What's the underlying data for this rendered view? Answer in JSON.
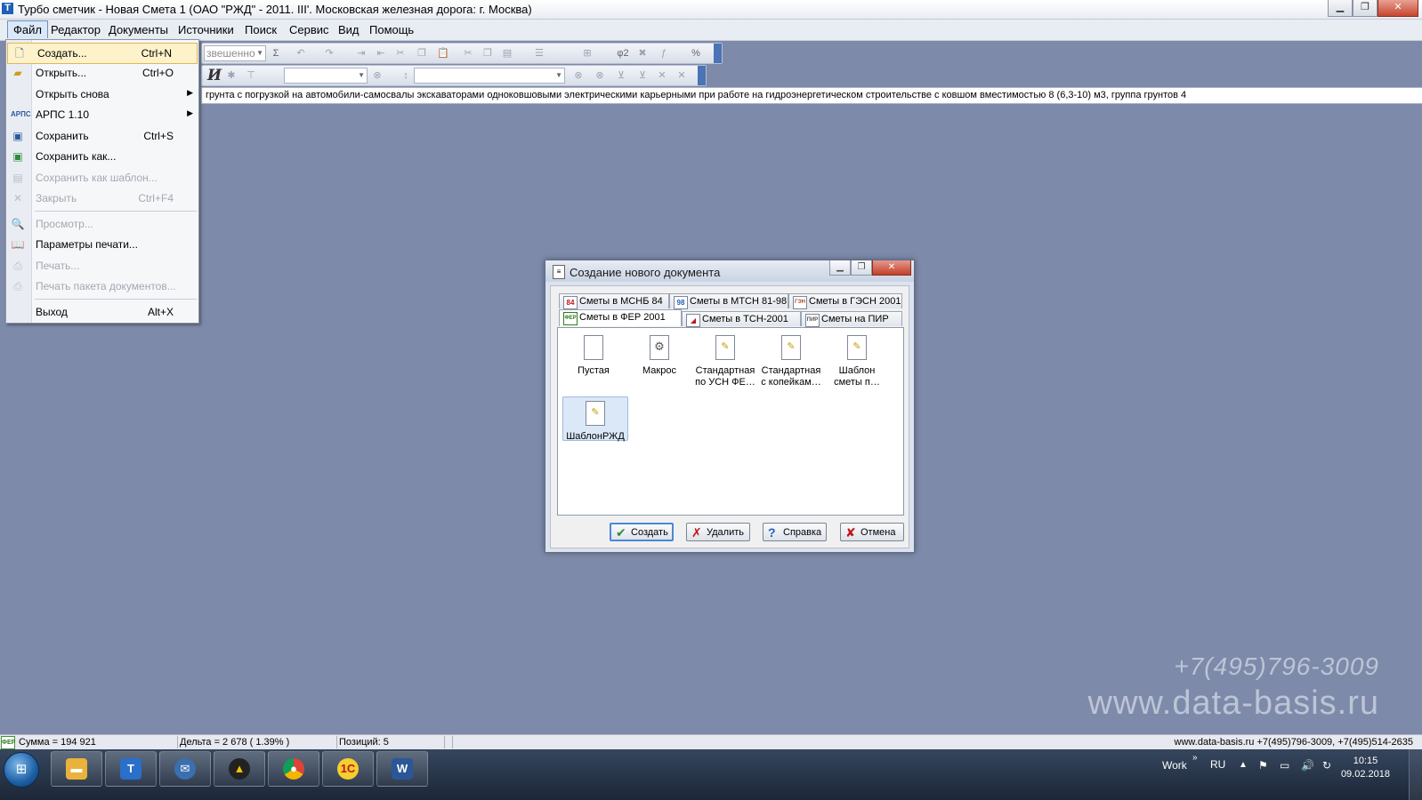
{
  "window": {
    "title": "Турбо сметчик - Новая Смета 1 (ОАО \"РЖД\" - 2011. ІІІ'. Московская железная дорога: г. Москва)",
    "min_label": "▁",
    "max_label": "❐",
    "close_label": "✕"
  },
  "menubar": {
    "items": [
      "Файл",
      "Редактор",
      "Документы",
      "Источники",
      "Поиск",
      "Сервис",
      "Вид",
      "Помощь"
    ]
  },
  "toolbar": {
    "weight_combo": "звешенно",
    "sigma": "Σ",
    "phi": "φ2",
    "percent": "%",
    "italic": "И"
  },
  "infobar": {
    "text": "грунта с погрузкой на автомобили-самосвалы экскаваторами одноковшовыми электрическими карьерными при работе на гидроэнергетическом строительстве с ковшом вместимостью 8 (6,3-10) м3, группа грунтов 4"
  },
  "file_menu": {
    "items": [
      {
        "label": "Создать...",
        "shortcut": "Ctrl+N",
        "icon": "new-doc-icon",
        "state": "highlighted"
      },
      {
        "label": "Открыть...",
        "shortcut": "Ctrl+O",
        "icon": "open-folder-icon",
        "state": "enabled"
      },
      {
        "label": "Открыть снова",
        "shortcut": "",
        "icon": "",
        "state": "submenu"
      },
      {
        "label": "АРПС 1.10",
        "shortcut": "",
        "icon": "arps-icon",
        "state": "submenu"
      },
      {
        "label": "Сохранить",
        "shortcut": "Ctrl+S",
        "icon": "save-icon",
        "state": "enabled"
      },
      {
        "label": "Сохранить как...",
        "shortcut": "",
        "icon": "save-as-icon",
        "state": "enabled"
      },
      {
        "label": "Сохранить как шаблон...",
        "shortcut": "",
        "icon": "save-template-icon",
        "state": "disabled"
      },
      {
        "label": "Закрыть",
        "shortcut": "Ctrl+F4",
        "icon": "close-doc-icon",
        "state": "disabled"
      },
      {
        "label": "Просмотр...",
        "shortcut": "",
        "icon": "preview-icon",
        "state": "disabled"
      },
      {
        "label": "Параметры печати...",
        "shortcut": "",
        "icon": "print-settings-icon",
        "state": "enabled"
      },
      {
        "label": "Печать...",
        "shortcut": "",
        "icon": "print-icon",
        "state": "disabled"
      },
      {
        "label": "Печать пакета документов...",
        "shortcut": "",
        "icon": "print-batch-icon",
        "state": "disabled"
      },
      {
        "label": "Выход",
        "shortcut": "Alt+X",
        "icon": "",
        "state": "enabled"
      }
    ],
    "submenu_arrow": "▶"
  },
  "dialog": {
    "title": "Создание нового документа",
    "tabs_row1": [
      {
        "label": "Сметы в МСНБ 84",
        "badge": "84"
      },
      {
        "label": "Сметы в МТСН 81-98",
        "badge": "98"
      },
      {
        "label": "Сметы в ГЭСН 2001",
        "badge": "ГЭН"
      }
    ],
    "tabs_row2": [
      {
        "label": "Сметы в ФЕР 2001",
        "badge": "ФЕР"
      },
      {
        "label": "Сметы в ТСН-2001",
        "badge": "◢"
      },
      {
        "label": "Сметы на ПИР",
        "badge": "ПИР"
      }
    ],
    "templates": [
      "Пустая",
      "Макрос",
      "Стандартная\nпо УСН ФЕ…",
      "Стандартная\nс копейкам…",
      "Шаблон\nсметы п…",
      "ШаблонРЖД"
    ],
    "buttons": {
      "create": "Создать",
      "delete": "Удалить",
      "help": "Справка",
      "cancel": "Отмена"
    }
  },
  "watermark": {
    "phone": "+7(495)796-3009",
    "site": "www.data-basis.ru"
  },
  "statusbar": {
    "sum": "Сумма = 194 921",
    "delta": "Дельта = 2 678 ( 1.39% )",
    "positions": "Позиций: 5",
    "contacts": "www.data-basis.ru  +7(495)796-3009, +7(495)514-2635",
    "badge": "ФЕР"
  },
  "taskbar": {
    "apps": [
      "explorer",
      "turbo-smetchik",
      "thunderbird",
      "archicad",
      "chrome",
      "1c",
      "word"
    ],
    "work_label": "Work",
    "lang": "RU",
    "time": "10:15",
    "date": "09.02.2018"
  },
  "colors": {
    "desktop": "#7d8aa9",
    "menu_highlight": "#fdf2c9",
    "accent": "#4a88d6"
  }
}
